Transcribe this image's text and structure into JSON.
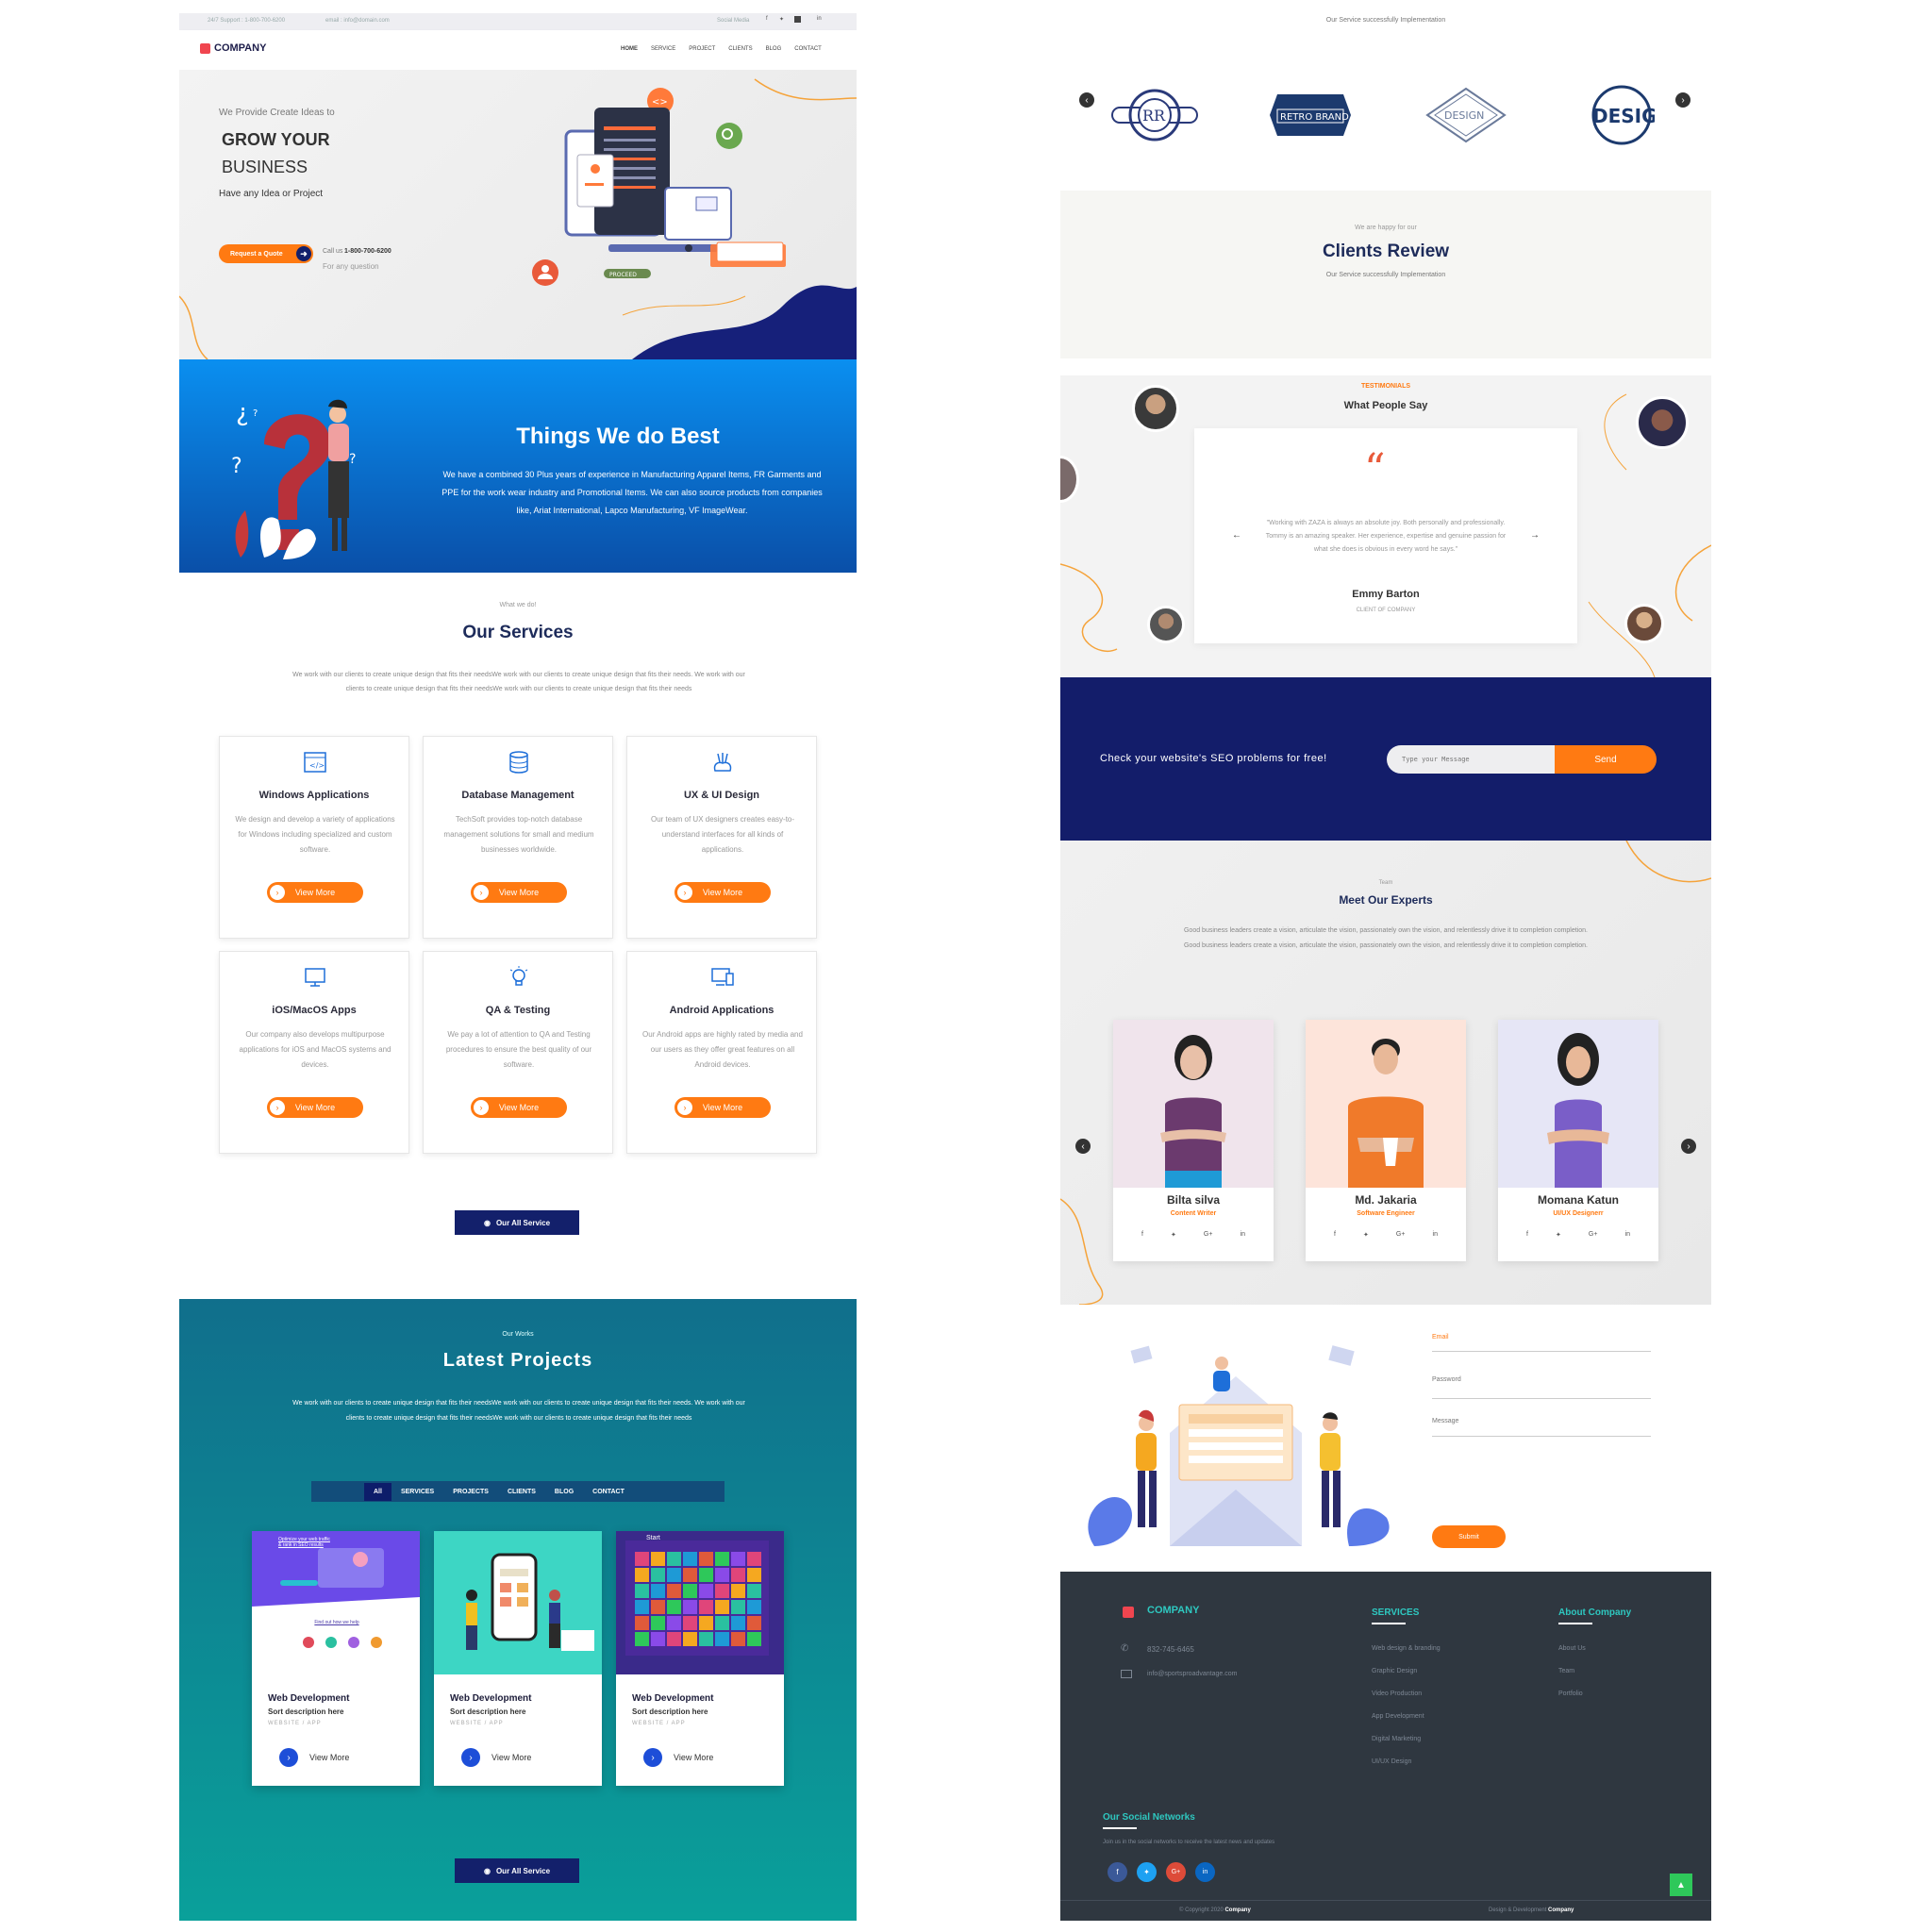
{
  "topbar": {
    "support": "24/7 Support : 1-800-700-6200",
    "email": "email : info@domain.com",
    "social_label": "Social Media"
  },
  "header": {
    "logo": "COMPANY",
    "nav": [
      "HOME",
      "SERVICE",
      "PROJECT",
      "CLIENTS",
      "BLOG",
      "CONTACT"
    ]
  },
  "hero": {
    "kicker": "We Provide Create Ideas to",
    "title_line1": "GROW YOUR",
    "title_line2": "BUSINESS",
    "subtitle": "Have any Idea or Project",
    "cta": "Request a Quote",
    "call_label": "Call us",
    "phone": "1-800-700-6200",
    "call_sub": "For any question",
    "illustration_badge": "PROCEED"
  },
  "best": {
    "title": "Things We do Best",
    "text": "We have a combined 30 Plus years of experience in Manufacturing Apparel Items, FR Garments and PPE for the work wear industry and Promotional Items. We can also source products from companies like, Ariat International, Lapco Manufacturing, VF ImageWear."
  },
  "services": {
    "kicker": "What we do!",
    "title": "Our Services",
    "intro": "We work with our clients to create unique design that fits their needsWe work with our clients to create unique design that fits their needs. We work with our clients to create unique design that fits their needsWe work with our clients to create unique design that fits their needs",
    "view_more": "View More",
    "all_button": "Our All Service",
    "items": [
      {
        "icon": "code-window-icon",
        "title": "Windows Applications",
        "desc": "We design and develop a variety of applications for Windows including specialized and custom software."
      },
      {
        "icon": "database-icon",
        "title": "Database Management",
        "desc": "TechSoft provides top-notch database management solutions for small and medium businesses worldwide."
      },
      {
        "icon": "design-hand-icon",
        "title": "UX & UI Design",
        "desc": "Our team of UX designers creates easy-to-understand interfaces for all kinds of applications."
      },
      {
        "icon": "monitor-icon",
        "title": "iOS/MacOS Apps",
        "desc": "Our company also develops multipurpose applications for iOS and MacOS systems and devices."
      },
      {
        "icon": "lightbulb-icon",
        "title": "QA & Testing",
        "desc": "We pay a lot of attention to QA and Testing procedures to ensure the best quality of our software."
      },
      {
        "icon": "devices-icon",
        "title": "Android Applications",
        "desc": "Our Android apps are highly rated by media and our users as they offer great features on all Android devices."
      }
    ]
  },
  "projects": {
    "kicker": "Our Works",
    "title": "Latest Projects",
    "intro": "We work with our clients to create unique design that fits their needsWe work with our clients to create unique design that fits their needs. We work with our clients to create unique design that fits their needsWe work with our clients to create unique design that fits their needs",
    "tabs": [
      "All",
      "SERVICES",
      "PROJECTS",
      "CLIENTS",
      "BLOG",
      "CONTACT"
    ],
    "all_button": "Our All Service",
    "items": [
      {
        "title": "Web Development",
        "sub": "Sort description here",
        "cat": "WEBSITE / APP",
        "cta": "View More",
        "mock_heading": "Optimize your web traffic & rank in SEO results",
        "mock_sub": "Find out how we help"
      },
      {
        "title": "Web Development",
        "sub": "Sort description here",
        "cat": "WEBSITE / APP",
        "cta": "View More"
      },
      {
        "title": "Web Development",
        "sub": "Sort description here",
        "cat": "WEBSITE / APP",
        "cta": "View More",
        "mock_heading": "Start"
      }
    ]
  },
  "brands": {
    "caption": "Our Service successfully Implementation",
    "logos": [
      "RR",
      "RETRO BRAND",
      "DESIGN",
      "DESIGN"
    ]
  },
  "reviews": {
    "kicker": "We are happy for our",
    "title": "Clients Review",
    "caption": "Our Service successfully Implementation"
  },
  "testimonials": {
    "kicker": "TESTIMONIALS",
    "title": "What People Say",
    "quote": "\"Working with ZAZA is always an absolute joy. Both personally and professionally. Tommy is an amazing speaker. Her experience, expertise and genuine passion for what she does is obvious in every word he says.\"",
    "name": "Emmy Barton",
    "role": "CLIENT OF COMPANY"
  },
  "seo": {
    "text": "Check your website's SEO problems for free!",
    "placeholder": "Type your Message",
    "button": "Send"
  },
  "experts": {
    "kicker": "Team",
    "title": "Meet Our Experts",
    "intro": "Good business leaders create a vision, articulate the vision, passionately own the vision, and relentlessly drive it to completion completion. Good business leaders create a vision, articulate the vision, passionately own the vision, and relentlessly drive it to completion completion.",
    "members": [
      {
        "name": "Bilta silva",
        "role": "Content Writer",
        "bg": "#f0e4ec",
        "shirt": "#6b3a6e"
      },
      {
        "name": "Md. Jakaria",
        "role": "Software Engineer",
        "bg": "#fde4da",
        "shirt": "#f07a2a"
      },
      {
        "name": "Momana Katun",
        "role": "UI/UX Designerr",
        "bg": "#e6e6f6",
        "shirt": "#7a5ec8"
      }
    ]
  },
  "contact": {
    "email_label": "Email",
    "password_label": "Password",
    "message_label": "Message",
    "submit": "Submit"
  },
  "footer": {
    "logo": "COMPANY",
    "phone": "832-745-6465",
    "email": "info@sportsproadvantage.com",
    "services_title": "SERVICES",
    "services": [
      "Web design & branding",
      "Graphic Design",
      "Video Production",
      "App Development",
      "Digital Marketing",
      "UI/UX Design"
    ],
    "about_title": "About Company",
    "about": [
      "About Us",
      "Team",
      "Portfolio"
    ],
    "social_title": "Our Social Networks",
    "social_text": "Join us in the social networks to receive the latest news and updates",
    "copyright": "© Copyright 2020",
    "copyright_brand": "Company",
    "design_by": "Design & Development",
    "design_brand": "Company"
  },
  "colors": {
    "orange": "#ff7a12",
    "navy": "#13206b",
    "blue": "#0a6fd6",
    "teal": "#0a9b9a",
    "footer": "#2f3740",
    "brand_red": "#f0454f"
  }
}
